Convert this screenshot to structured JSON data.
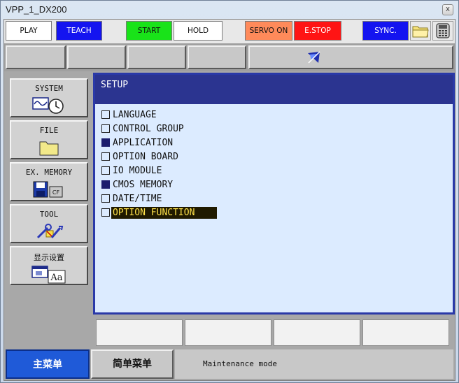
{
  "window": {
    "title": "VPP_1_DX200",
    "close_glyph": "x"
  },
  "toolbar": {
    "play": "PLAY",
    "teach": "TEACH",
    "start": "START",
    "hold": "HOLD",
    "servo_on": "SERVO ON",
    "estop": "E.STOP",
    "sync": "SYNC.",
    "icons": [
      "folder-icon",
      "pendant-icon"
    ]
  },
  "left_menu": [
    {
      "label": "SYSTEM",
      "icon": "system-clock-icon"
    },
    {
      "label": "FILE",
      "icon": "folder-icon"
    },
    {
      "label": "EX. MEMORY",
      "icon": "memory-card-icon"
    },
    {
      "label": "TOOL",
      "icon": "tools-icon"
    },
    {
      "label": "显示设置",
      "icon": "display-settings-icon"
    }
  ],
  "main": {
    "title": "SETUP",
    "items": [
      {
        "label": "LANGUAGE",
        "filled": false,
        "selected": false
      },
      {
        "label": "CONTROL GROUP",
        "filled": false,
        "selected": false
      },
      {
        "label": "APPLICATION",
        "filled": true,
        "selected": false
      },
      {
        "label": "OPTION BOARD",
        "filled": false,
        "selected": false
      },
      {
        "label": "IO MODULE",
        "filled": false,
        "selected": false
      },
      {
        "label": "CMOS MEMORY",
        "filled": true,
        "selected": false
      },
      {
        "label": "DATE/TIME",
        "filled": false,
        "selected": false
      },
      {
        "label": "OPTION FUNCTION",
        "filled": false,
        "selected": true
      }
    ]
  },
  "statusbar": {
    "main_menu": "主菜单",
    "simple_menu": "简单菜单",
    "message": "Maintenance mode"
  },
  "colors": {
    "header_blue": "#2b3490",
    "main_bg": "#dcebff",
    "teach_blue": "#1414f0",
    "start_green": "#19e319",
    "estop_red": "#ff1414",
    "servo_orange": "#ff8a5a",
    "selection_text": "#ffe24a"
  }
}
